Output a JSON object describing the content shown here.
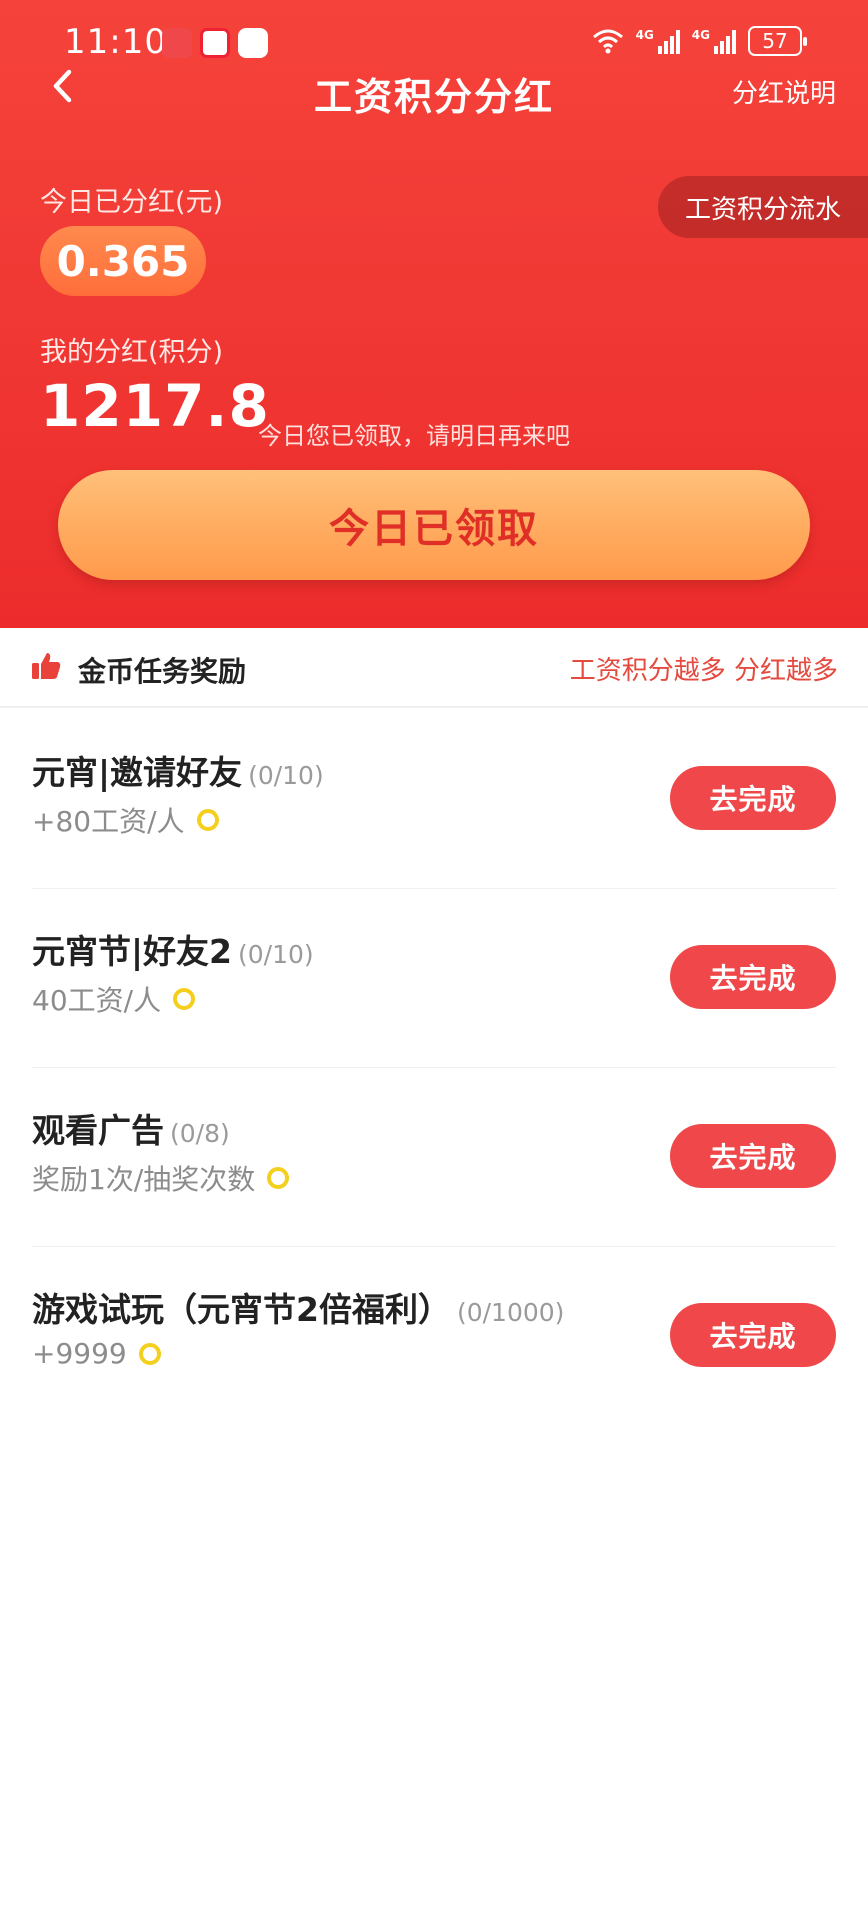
{
  "status_bar": {
    "time": "11:10",
    "battery": "57",
    "signal1_label": "4G",
    "signal2_label": "4G"
  },
  "nav": {
    "title": "工资积分分红",
    "right_link": "分红说明"
  },
  "header": {
    "flow_button": "工资积分流水",
    "today_label": "今日已分红(元)",
    "today_value": "0.365",
    "my_label": "我的分红(积分)",
    "my_value": "1217.8",
    "hint": "今日您已领取，请明日再来吧",
    "claim_button": "今日已领取"
  },
  "section": {
    "title": "金币任务奖励",
    "slogan": "工资积分越多 分红越多"
  },
  "tasks": [
    {
      "name": "元宵|邀请好友",
      "progress": "(0/10)",
      "reward": "+80工资/人",
      "button": "去完成"
    },
    {
      "name": "元宵节|好友2",
      "progress": "(0/10)",
      "reward": "40工资/人",
      "button": "去完成"
    },
    {
      "name": "观看广告",
      "progress": "(0/8)",
      "reward": "奖励1次/抽奖次数",
      "button": "去完成"
    },
    {
      "name": "游戏试玩（元宵节2倍福利）",
      "progress": "(0/1000)",
      "reward": "+9999",
      "button": "去完成"
    }
  ],
  "colors": {
    "header_red": "#f13a35",
    "claim_orange": "#ffab5f",
    "action_red": "#f0484a",
    "coin_yellow": "#f5cf1d"
  }
}
